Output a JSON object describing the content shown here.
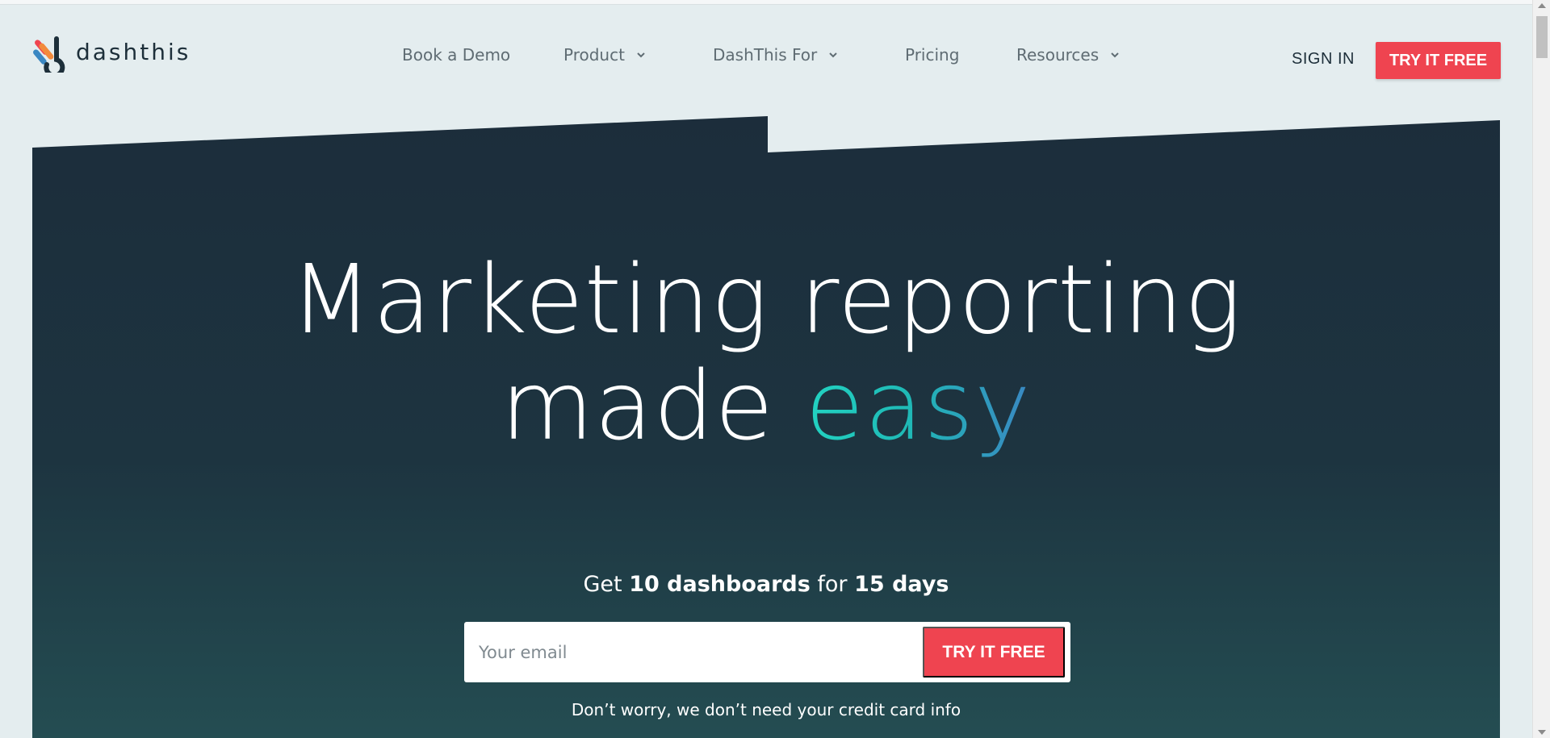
{
  "brand": {
    "name": "dashthis"
  },
  "nav": {
    "items": [
      {
        "label": "Book a Demo",
        "dropdown": false
      },
      {
        "label": "Product",
        "dropdown": true
      },
      {
        "label": "DashThis For",
        "dropdown": true
      },
      {
        "label": "Pricing",
        "dropdown": false
      },
      {
        "label": "Resources",
        "dropdown": true
      }
    ],
    "sign_in": "SIGN IN",
    "cta": "TRY IT FREE"
  },
  "hero": {
    "title_line1": "Marketing reporting",
    "title_line2_prefix": "made ",
    "title_line2_accent": "easy",
    "offer": {
      "pre": "Get ",
      "dashboards": "10 dashboards",
      "mid": " for ",
      "days": "15 days"
    },
    "email_placeholder": "Your email",
    "cta": "TRY IT FREE",
    "note": "Don’t worry, we don’t need your credit card info"
  },
  "colors": {
    "page_bg": "#e4edef",
    "hero_top": "#1c2d3b",
    "hero_bottom": "#244d52",
    "cta": "#ef4450",
    "accent_start": "#22d3c1",
    "accent_end": "#3a87c2"
  }
}
